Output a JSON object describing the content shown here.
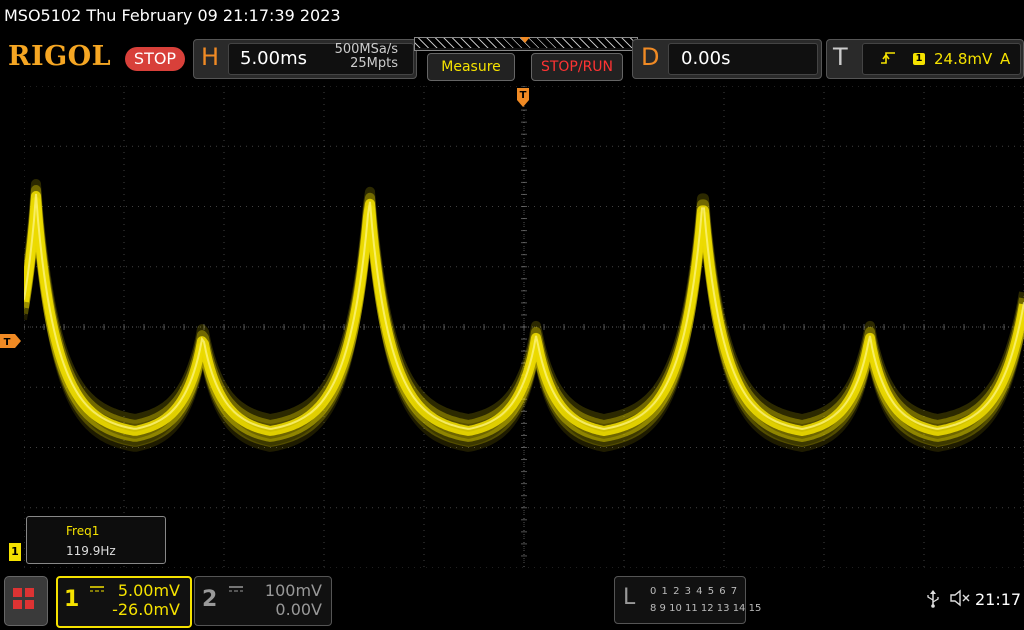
{
  "title_bar": {
    "text": "MSO5102  Thu February 09 21:17:39 2023"
  },
  "toolbar": {
    "logo": "RIGOL",
    "run_state": "STOP",
    "horizontal": {
      "letter": "H",
      "scale": "5.00ms",
      "sample_rate": "500MSa/s",
      "memory_depth": "25Mpts"
    },
    "measure_label": "Measure",
    "stop_run_label": "STOP/RUN",
    "delay": {
      "letter": "D",
      "value": "0.00s"
    },
    "trigger": {
      "letter": "T",
      "edge_icon": "rising-edge-icon",
      "channel": "1",
      "level": "24.8mV",
      "mode": "A"
    }
  },
  "waveform": {
    "channel": "1",
    "color": "#f5e200",
    "frequency_hz": 119.9,
    "trigger_level_marker": "T",
    "channel_marker": "1"
  },
  "measurement": {
    "label": "Freq1",
    "value": "119.9Hz"
  },
  "channels": [
    {
      "num": "1",
      "coupling": "DC",
      "scale": "5.00mV",
      "offset": "-26.0mV",
      "active": true,
      "color": "#f5e200"
    },
    {
      "num": "2",
      "coupling": "DC",
      "scale": "100mV",
      "offset": "0.00V",
      "active": false,
      "color": "#999999"
    }
  ],
  "logic_analyzer": {
    "letter": "L",
    "row1": "0 1 2 3  4 5 6 7",
    "row2": "8 9 10 11 12 13 14 15"
  },
  "status": {
    "time": "21:17",
    "icons": [
      "usb-icon",
      "speaker-muted-icon"
    ]
  },
  "colors": {
    "accent_orange": "#f08a24",
    "trace_yellow": "#f5e200",
    "stop_red": "#d8403a"
  }
}
